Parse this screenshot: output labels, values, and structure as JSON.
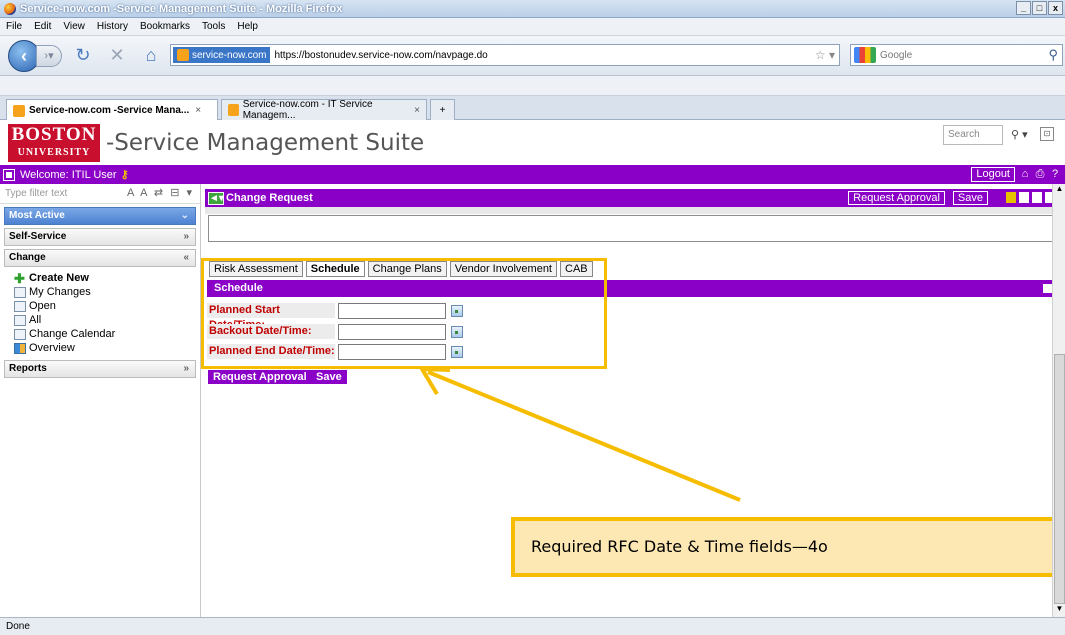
{
  "window": {
    "title": "Service-now.com -Service Management Suite - Mozilla Firefox",
    "controls": [
      "_",
      "□",
      "x"
    ]
  },
  "menubar": [
    "File",
    "Edit",
    "View",
    "History",
    "Bookmarks",
    "Tools",
    "Help"
  ],
  "navbar": {
    "site_identity": "service-now.com",
    "url": "https://bostonudev.service-now.com/navpage.do",
    "search_placeholder": "Google"
  },
  "browser_tabs": [
    {
      "label": "Service-now.com -Service Mana...",
      "close": "×",
      "active": true
    },
    {
      "label": "Service-now.com - IT Service Managem...",
      "close": "×",
      "active": false
    },
    {
      "label": "+",
      "active": false
    }
  ],
  "header": {
    "logo_line1": "BOSTON",
    "logo_line2": "UNIVERSITY",
    "suite_title": "-Service Management Suite",
    "search_placeholder": "Search"
  },
  "welcomebar": {
    "text": "Welcome: ITIL User",
    "logout_label": "Logout"
  },
  "leftnav": {
    "filter_placeholder": "Type filter text",
    "filter_tools": "A A ⇄ ⊟ ▾",
    "sections": {
      "most_active": "Most Active",
      "self_service": "Self-Service",
      "change": "Change",
      "reports": "Reports"
    },
    "change_items": [
      {
        "label": "Create New",
        "icon": "create-new-icon"
      },
      {
        "label": "My Changes",
        "icon": "list-icon"
      },
      {
        "label": "Open",
        "icon": "list-icon"
      },
      {
        "label": "All",
        "icon": "list-icon"
      },
      {
        "label": "Change Calendar",
        "icon": "calendar-icon"
      },
      {
        "label": "Overview",
        "icon": "overview-icon"
      }
    ]
  },
  "form": {
    "title": "Change Request",
    "request_approval_label": "Request Approval",
    "save_label": "Save",
    "tabs": [
      "Risk Assessment",
      "Schedule",
      "Change Plans",
      "Vendor Involvement",
      "CAB"
    ],
    "active_tab": "Schedule",
    "section_title": "Schedule",
    "fields": [
      {
        "label": "Planned Start Date/Time:",
        "value": ""
      },
      {
        "label": "Backout Date/Time:",
        "value": ""
      },
      {
        "label": "Planned End Date/Time:",
        "value": ""
      }
    ],
    "bottom_request_approval": "Request Approval",
    "bottom_save": "Save"
  },
  "callout": {
    "text": "Required RFC Date & Time fields—4o"
  },
  "status": "Done",
  "colors": {
    "accent_purple": "#8b00c6",
    "highlight_yellow": "#f6bd00",
    "required_red": "#c00000",
    "bu_red": "#c8102e"
  }
}
